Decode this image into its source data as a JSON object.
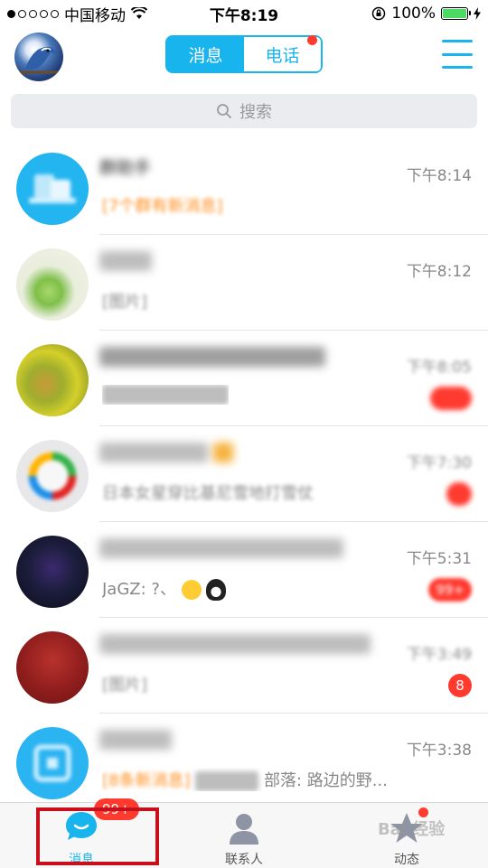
{
  "status_bar": {
    "carrier": "中国移动",
    "time": "下午8:19",
    "battery_percent": "100%",
    "signal_icon": "signal-dots-icon",
    "wifi_icon": "wifi-icon",
    "lock_icon": "orientation-lock-icon",
    "battery_icon": "battery-icon"
  },
  "header": {
    "avatar_icon": "user-avatar-bird",
    "tabs": [
      {
        "label": "消息",
        "active": true
      },
      {
        "label": "电话",
        "active": false,
        "has_dot": true
      }
    ],
    "menu_icon": "hamburger-menu-icon",
    "accent_color": "#18b4ed"
  },
  "search": {
    "placeholder": "搜索",
    "icon": "search-icon"
  },
  "conversations": [
    {
      "name": "群助手",
      "time": "下午8:14",
      "preview": "[7个群有新消息]",
      "preview_color": "orange",
      "badge": ""
    },
    {
      "name": "",
      "time": "下午8:12",
      "preview": "[图片]",
      "preview_color": "gray",
      "badge": ""
    },
    {
      "name": "",
      "time": "下午8:05",
      "preview": "",
      "preview_color": "gray",
      "badge": ""
    },
    {
      "name": "",
      "time": "下午7:30",
      "preview": "日本女星穿比基尼雪地打雪仗",
      "preview_color": "gray",
      "badge": ""
    },
    {
      "name": "",
      "time": "下午5:31",
      "preview": "JaGZ: ?、",
      "preview_color": "gray",
      "badge": "99+"
    },
    {
      "name": "",
      "time": "下午3:49",
      "preview": "[图片]",
      "preview_color": "gray",
      "badge": "8"
    },
    {
      "name": "",
      "time": "下午3:38",
      "preview_prefix": "[8条新消息]",
      "preview": "部落: 路边的野...",
      "preview_color": "orange",
      "badge": ""
    }
  ],
  "tab_bar": {
    "items": [
      {
        "label": "消息",
        "icon": "chat-bubble-icon",
        "badge": "99+",
        "active": true
      },
      {
        "label": "联系人",
        "icon": "contacts-person-icon",
        "active": false
      },
      {
        "label": "动态",
        "icon": "star-feed-icon",
        "active": false,
        "has_dot": true
      }
    ]
  },
  "watermark": "Bai 经验"
}
